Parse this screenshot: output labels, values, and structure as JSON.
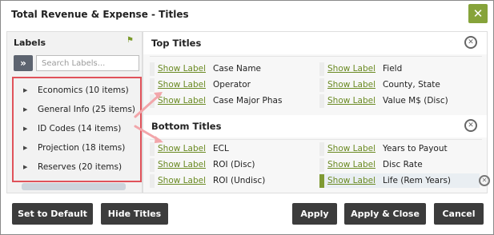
{
  "dialog": {
    "title": "Total Revenue & Expense - Titles",
    "close_glyph": "✕"
  },
  "labels": {
    "header": "Labels",
    "expand_glyph": "»",
    "search_placeholder": "Search Labels...",
    "items": [
      {
        "label": "Economics (10 items)"
      },
      {
        "label": "General Info (25 items)"
      },
      {
        "label": "ID Codes (14 items)"
      },
      {
        "label": "Projection (18 items)"
      },
      {
        "label": "Reserves (20 items)"
      }
    ]
  },
  "top_titles": {
    "header": "Top Titles",
    "rows": [
      {
        "left_link": "Show Label",
        "left_value": "Case Name",
        "right_link": "Show Label",
        "right_value": "Field"
      },
      {
        "left_link": "Show Label",
        "left_value": "Operator",
        "right_link": "Show Label",
        "right_value": "County, State"
      },
      {
        "left_link": "Show Label",
        "left_value": "Case Major Phas",
        "right_link": "Show Label",
        "right_value": "Value M$ (Disc)"
      }
    ]
  },
  "bottom_titles": {
    "header": "Bottom Titles",
    "rows": [
      {
        "left_link": "Show Label",
        "left_value": "ECL",
        "right_link": "Show Label",
        "right_value": "Years to Payout"
      },
      {
        "left_link": "Show Label",
        "left_value": "ROI (Disc)",
        "right_link": "Show Label",
        "right_value": "Disc Rate"
      },
      {
        "left_link": "Show Label",
        "left_value": "ROI (Undisc)",
        "right_link": "Show Label",
        "right_value": "Life (Rem Years)"
      }
    ]
  },
  "footer": {
    "set_default": "Set to Default",
    "hide_titles": "Hide Titles",
    "apply": "Apply",
    "apply_close": "Apply & Close",
    "cancel": "Cancel"
  },
  "colors": {
    "accent": "#86a33a",
    "link": "#6a8a22",
    "highlight": "#e0525a",
    "button": "#3c3c3c"
  }
}
